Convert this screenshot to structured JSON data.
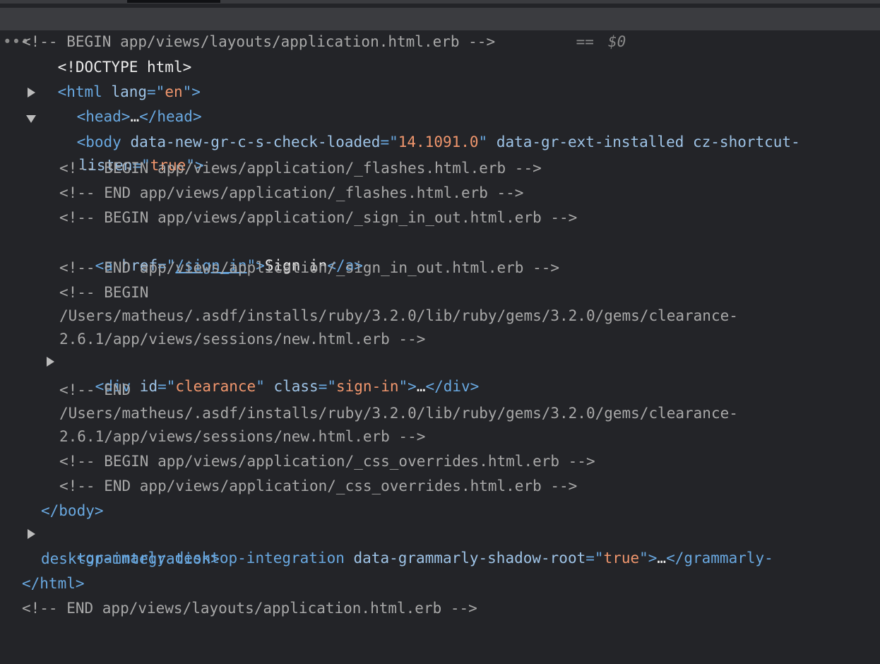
{
  "nodes": {
    "layout_begin": {
      "ellipsis": "•••",
      "text": "<!-- BEGIN app/views/layouts/application.html.erb -->",
      "eq": " == ",
      "dollar": "$0"
    },
    "doctype": "<!DOCTYPE html>",
    "html_open": {
      "open": "<html ",
      "attr": "lang",
      "eqq": "=\"",
      "val": "en",
      "close": "\">"
    },
    "head": {
      "open": "<head>",
      "ellipsis": "…",
      "close": "</head>"
    },
    "body_open": {
      "open": "<body ",
      "attr1": "data-new-gr-c-s-check-loaded",
      "eqq1": "=\"",
      "val1": "14.1091.0",
      "q1": "\"",
      "attr2": " data-gr-ext-installed cz-shortcut-",
      "attr2b": "listen",
      "eqq2": "=\"",
      "val2": "true",
      "close": "\">"
    },
    "flashes_begin": "<!-- BEGIN app/views/application/_flashes.html.erb -->",
    "flashes_end": "<!-- END app/views/application/_flashes.html.erb -->",
    "signinout_begin": "<!-- BEGIN app/views/application/_sign_in_out.html.erb -->",
    "sign_in_link": {
      "open": "<a ",
      "attr": "href",
      "eqq": "=\"",
      "href": "/sign_in",
      "q": "\">",
      "text": "Sign in",
      "close": "</a>"
    },
    "signinout_end": "<!-- END app/views/application/_sign_in_out.html.erb -->",
    "sessions_begin": {
      "line1": "<!-- BEGIN",
      "line2": "/Users/matheus/.asdf/installs/ruby/3.2.0/lib/ruby/gems/3.2.0/gems/clearance-",
      "line3": "2.6.1/app/views/sessions/new.html.erb -->"
    },
    "div_clearance": {
      "open": "<div ",
      "attr1": "id",
      "eqq1": "=\"",
      "val1": "clearance",
      "q1": "\"",
      "attr2": " class",
      "eqq2": "=\"",
      "val2": "sign-in",
      "q2": "\">",
      "ellipsis": "…",
      "close": "</div>"
    },
    "sessions_end": {
      "line1": "<!-- END",
      "line2": "/Users/matheus/.asdf/installs/ruby/3.2.0/lib/ruby/gems/3.2.0/gems/clearance-",
      "line3": "2.6.1/app/views/sessions/new.html.erb -->"
    },
    "css_begin": "<!-- BEGIN app/views/application/_css_overrides.html.erb -->",
    "css_end": "<!-- END app/views/application/_css_overrides.html.erb -->",
    "body_close": "</body>",
    "grammarly": {
      "open": "<grammarly-desktop-integration ",
      "attr": "data-grammarly-shadow-root",
      "eqq": "=\"",
      "val": "true",
      "q": "\">",
      "ellipsis": "…",
      "close1": "</grammarly-",
      "close2": "desktop-integration>"
    },
    "html_close": "</html>",
    "layout_end": "<!-- END app/views/layouts/application.html.erb -->"
  },
  "icons": {
    "expand": "triangle-right-icon",
    "collapse": "triangle-down-icon"
  }
}
